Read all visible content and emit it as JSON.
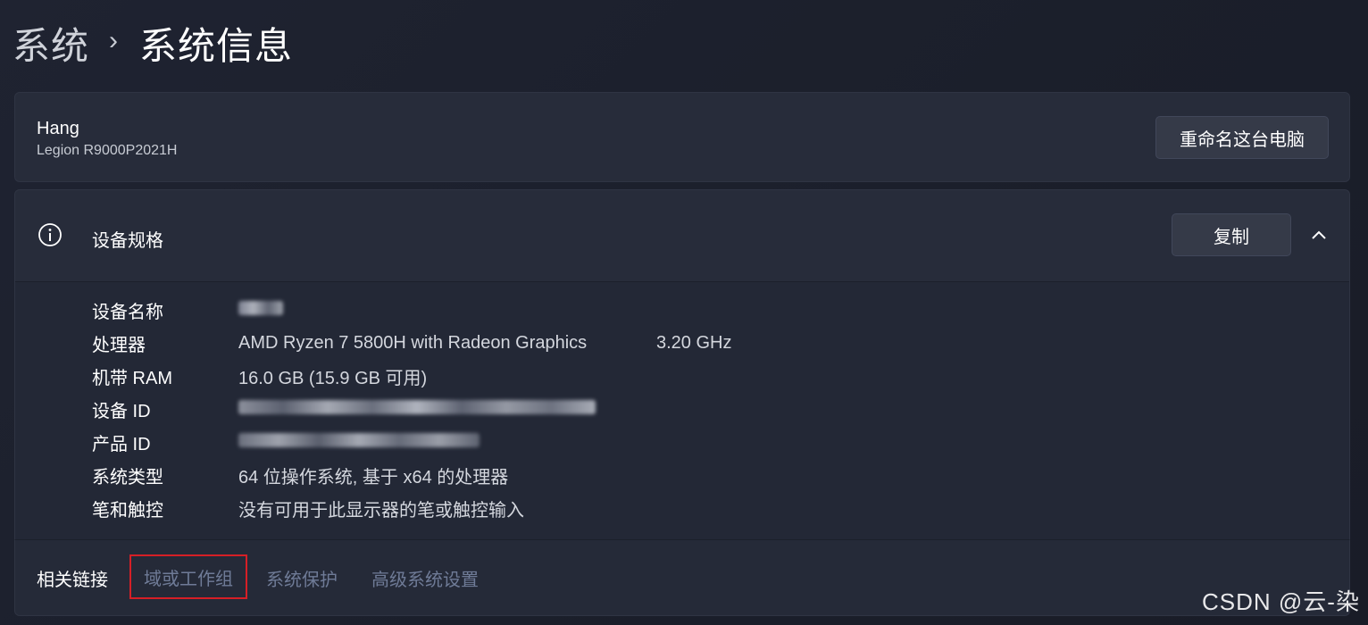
{
  "breadcrumb": {
    "parent": "系统",
    "separator": "›",
    "current": "系统信息"
  },
  "pc": {
    "name": "Hang",
    "model": "Legion R9000P2021H",
    "rename_button": "重命名这台电脑"
  },
  "specs": {
    "title": "设备规格",
    "copy_button": "复制",
    "rows": [
      {
        "label": "设备名称",
        "value": "",
        "redacted": true
      },
      {
        "label": "处理器",
        "value": "AMD Ryzen 7 5800H with Radeon Graphics",
        "value2": "3.20 GHz"
      },
      {
        "label": "机带 RAM",
        "value": "16.0 GB (15.9 GB 可用)"
      },
      {
        "label": "设备 ID",
        "value": "",
        "redacted": true
      },
      {
        "label": "产品 ID",
        "value": "",
        "redacted": true
      },
      {
        "label": "系统类型",
        "value": "64 位操作系统, 基于 x64 的处理器"
      },
      {
        "label": "笔和触控",
        "value": "没有可用于此显示器的笔或触控输入"
      }
    ]
  },
  "related": {
    "label": "相关链接",
    "links": [
      "域或工作组",
      "系统保护",
      "高级系统设置"
    ]
  },
  "watermark": "CSDN @云-染",
  "colors": {
    "background": "#1d2130",
    "card": "#272c3a",
    "link": "#6f7b97",
    "highlight_border": "#d61f26"
  }
}
